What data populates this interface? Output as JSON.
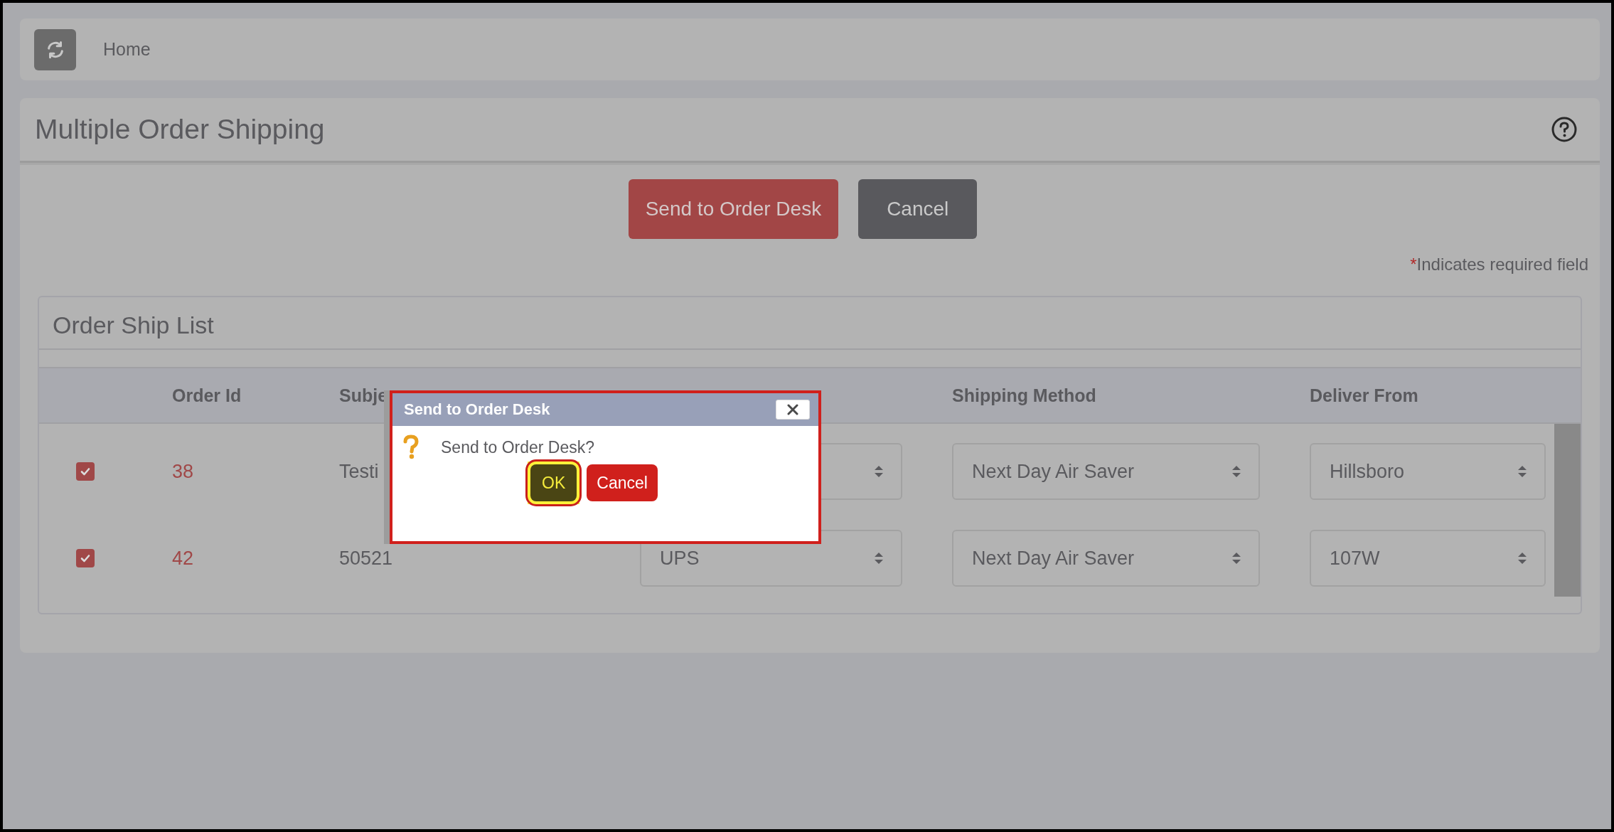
{
  "top_bar": {
    "breadcrumb": "Home"
  },
  "page": {
    "title": "Multiple Order Shipping"
  },
  "actions": [
    {
      "kind": "primary",
      "label": "Send to Order Desk"
    },
    {
      "kind": "secondary",
      "label": "Cancel"
    }
  ],
  "required_note": {
    "mark": "*",
    "text": "Indicates required field"
  },
  "order_list": {
    "title": "Order Ship List",
    "columns": {
      "order_id": "Order Id",
      "subject": "Subje",
      "shipping_method": "Shipping Method",
      "deliver_from": "Deliver From"
    },
    "rows": [
      {
        "checked": true,
        "order_id": "38",
        "subject": "Testi",
        "shipping_method": "Next Day Air Saver",
        "deliver_from": "Hillsboro"
      },
      {
        "checked": true,
        "order_id": "42",
        "subject": "50521",
        "carrier": "UPS",
        "shipping_method": "Next Day Air Saver",
        "deliver_from": "107W"
      }
    ]
  },
  "dialog": {
    "title": "Send to Order Desk",
    "message": "Send to Order Desk?",
    "buttons": [
      {
        "kind": "ok",
        "label": "OK",
        "focused": true
      },
      {
        "kind": "cancel",
        "label": "Cancel",
        "focused": false
      }
    ]
  }
}
